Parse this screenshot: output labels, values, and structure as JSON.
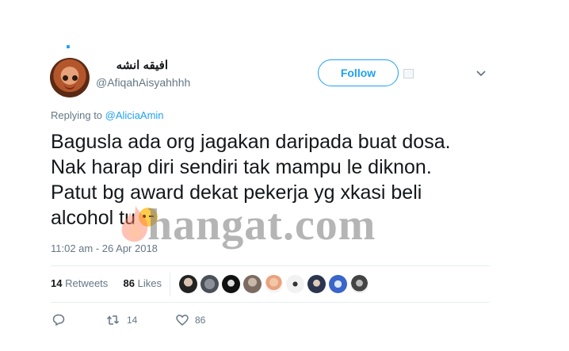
{
  "tweet": {
    "display_name": "افيقه انشه",
    "handle": "@AfiqahAisyahhhh",
    "follow_label": "Follow",
    "replying_prefix": "Replying to ",
    "replying_to": "@AliciaAmin",
    "text_lines": [
      "Bagusla ada org jagakan daripada buat dosa.",
      "Nak harap diri sendiri tak mampu le diknon.",
      "Patut bg award dekat pekerja yg xkasi beli",
      "alcohol tu"
    ],
    "timestamp": "11:02 am - 26 Apr 2018",
    "retweets_count": "14",
    "retweets_label": "Retweets",
    "likes_count": "86",
    "likes_label": "Likes",
    "reply_icon": "reply-icon",
    "retweet_action_count": "14",
    "like_action_count": "86"
  },
  "watermark": {
    "text": "hangat.com"
  },
  "colors": {
    "accent": "#1da1f2",
    "muted": "#657786",
    "text": "#14171a"
  }
}
